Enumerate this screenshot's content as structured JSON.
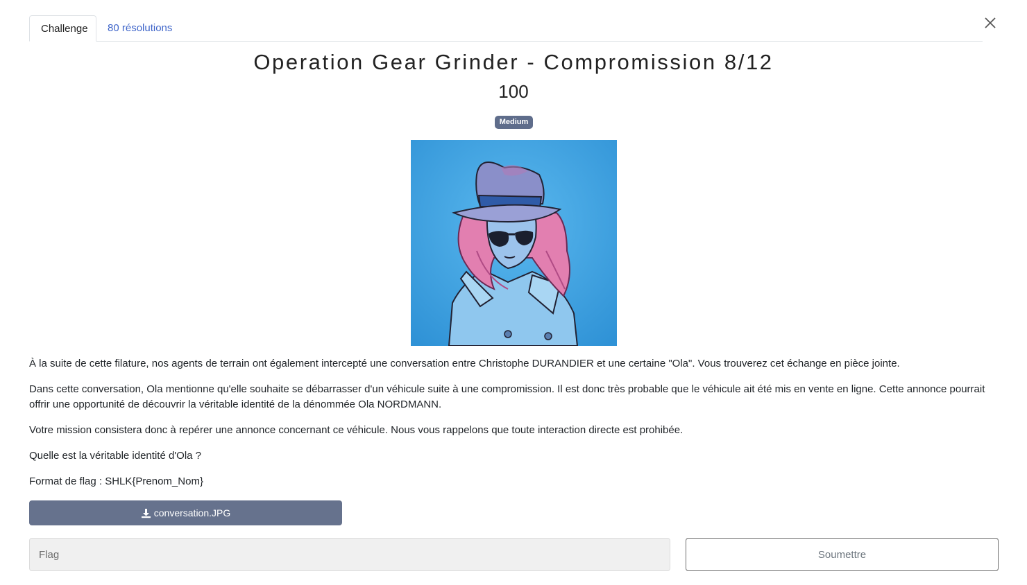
{
  "tabs": {
    "challenge_label": "Challenge",
    "solves_label": "80 résolutions"
  },
  "challenge": {
    "title": "Operation Gear Grinder - Compromission 8/12",
    "points": "100",
    "difficulty": "Medium",
    "description": [
      "À la suite de cette filature, nos agents de terrain ont également intercepté une conversation entre Christophe DURANDIER et une certaine \"Ola\". Vous trouverez cet échange en pièce jointe.",
      "Dans cette conversation, Ola mentionne qu'elle souhaite se débarrasser d'un véhicule suite à une compromission. Il est donc très probable que le véhicule ait été mis en vente en ligne. Cette annonce pourrait offrir une opportunité de découvrir la véritable identité de la dénommée Ola NORDMANN.",
      "Votre mission consistera donc à repérer une annonce concernant ce véhicule. Nous vous rappelons que toute interaction directe est prohibée.",
      "Quelle est la véritable identité d'Ola ?",
      "Format de flag : SHLK{Prenom_Nom}"
    ],
    "attachment": {
      "filename": "conversation.JPG",
      "icon": "download-icon"
    }
  },
  "form": {
    "flag_placeholder": "Flag",
    "flag_value": "",
    "submit_label": "Soumettre"
  },
  "colors": {
    "badge": "#5f6d8b",
    "download_button": "#66728d",
    "link": "#3f65c9",
    "art_background": "#3aa0e0"
  }
}
